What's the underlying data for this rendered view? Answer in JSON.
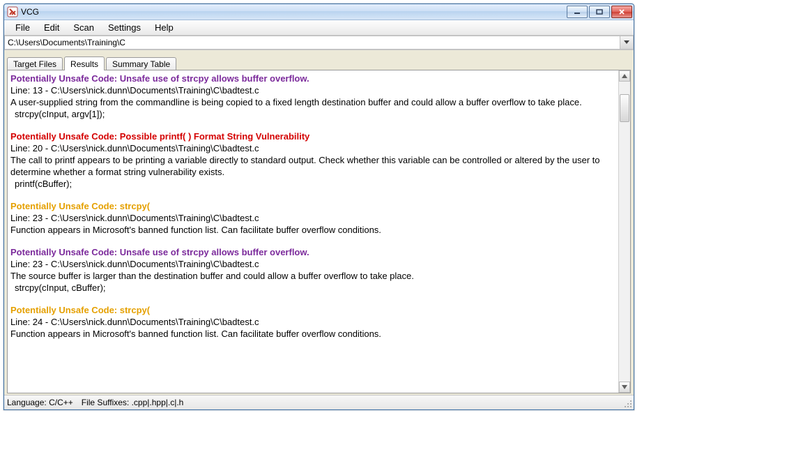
{
  "window": {
    "title": "VCG"
  },
  "menu": {
    "file": "File",
    "edit": "Edit",
    "scan": "Scan",
    "settings": "Settings",
    "help": "Help"
  },
  "path": {
    "value": "C:\\Users\\Documents\\Training\\C"
  },
  "tabs": {
    "target_files": "Target Files",
    "results": "Results",
    "summary_table": "Summary Table"
  },
  "findings": [
    {
      "severity": "purple",
      "header": "Potentially Unsafe Code: Unsafe use of strcpy allows buffer overflow.",
      "location": "Line: 13 - C:\\Users\\nick.dunn\\Documents\\Training\\C\\badtest.c",
      "description": "A user-supplied string from the commandline is being copied to a fixed length destination buffer and could allow a buffer overflow to take place.",
      "code": "strcpy(cInput, argv[1]);"
    },
    {
      "severity": "red",
      "header": "Potentially Unsafe Code: Possible printf( ) Format String Vulnerability",
      "location": "Line: 20 - C:\\Users\\nick.dunn\\Documents\\Training\\C\\badtest.c",
      "description": "The call to printf appears to be printing a variable directly to standard output. Check whether this variable can be controlled or altered by the user to determine whether a format string vulnerability exists.",
      "code": "  printf(cBuffer);"
    },
    {
      "severity": "orange",
      "header": "Potentially Unsafe Code: strcpy(",
      "location": "Line: 23 - C:\\Users\\nick.dunn\\Documents\\Training\\C\\badtest.c",
      "description": "Function appears in Microsoft's banned function list. Can facilitate buffer overflow conditions.",
      "code": ""
    },
    {
      "severity": "purple",
      "header": "Potentially Unsafe Code: Unsafe use of strcpy allows buffer overflow.",
      "location": "Line: 23 - C:\\Users\\nick.dunn\\Documents\\Training\\C\\badtest.c",
      "description": "The source buffer is larger than the destination buffer and could allow a buffer overflow to take place.",
      "code": "strcpy(cInput, cBuffer);"
    },
    {
      "severity": "orange",
      "header": "Potentially Unsafe Code: strcpy(",
      "location": "Line: 24 - C:\\Users\\nick.dunn\\Documents\\Training\\C\\badtest.c",
      "description": "Function appears in Microsoft's banned function list. Can facilitate buffer overflow conditions.",
      "code": ""
    }
  ],
  "status": {
    "language_label": "Language:",
    "language_value": "C/C++",
    "suffixes_label": "File Suffixes:",
    "suffixes_value": ".cpp|.hpp|.c|.h"
  }
}
